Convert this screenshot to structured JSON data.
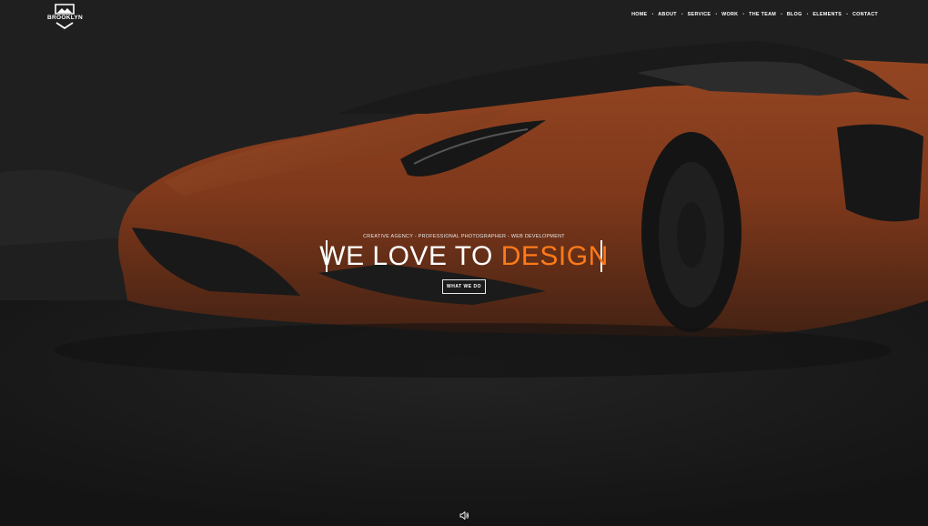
{
  "brand": {
    "name": "BROOKLYN"
  },
  "nav": {
    "items": [
      {
        "label": "HOME"
      },
      {
        "label": "ABOUT"
      },
      {
        "label": "SERVICE"
      },
      {
        "label": "WORK"
      },
      {
        "label": "THE TEAM"
      },
      {
        "label": "BLOG"
      },
      {
        "label": "ELEMENTS"
      },
      {
        "label": "CONTACT"
      }
    ],
    "separator": "•"
  },
  "hero": {
    "tagline": "CREATIVE AGENCY - PROFESSIONAL PHOTOGRAPHER - WEB DEVELOPMENT",
    "headline_prefix": "WE LOVE TO",
    "headline_accent": "DESIGN",
    "cta_label": "WHAT WE DO",
    "accent_color": "#ff7a1a"
  },
  "icons": {
    "logo": "shield-mountain-icon",
    "sound": "speaker-icon"
  }
}
